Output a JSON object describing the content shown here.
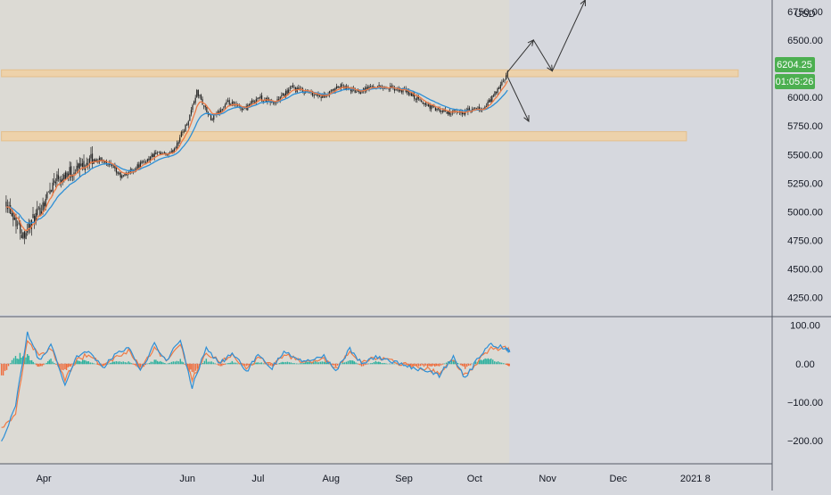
{
  "currency": "USD",
  "colors": {
    "background": "#d6d8de",
    "history_shade": "#dcdad4",
    "zone": "#f0d2a6",
    "zone_stroke": "#e6bd84",
    "candle": "#222222",
    "ema_fast": "#ef7a45",
    "ema_slow": "#2d8fd6",
    "hist_pos": "#2bb19e",
    "hist_neg": "#ef6b3b",
    "price_tag": "#4caf50",
    "divider": "#555a66",
    "arrow": "#333333"
  },
  "price_tag": {
    "value": "6204.25",
    "timer": "01:05:26"
  },
  "chart_data": [
    {
      "type": "line",
      "panel": "price",
      "title": "",
      "ylabel": "",
      "yaxis_unit": "USD",
      "ylim": [
        4100,
        6850
      ],
      "grid": false,
      "y_ticks": [
        4250,
        4500,
        4750,
        5000,
        5250,
        5500,
        5750,
        6000,
        6250,
        6500,
        6750
      ],
      "y_tick_labels": [
        "4250.00",
        "4500.00",
        "4750.00",
        "5000.00",
        "5250.00",
        "5500.00",
        "5750.00",
        "6000.00",
        "",
        "6500.00",
        "6750.00"
      ],
      "x_ticks": [
        {
          "label": "Apr",
          "date": "2020-04-01"
        },
        {
          "label": "Jun",
          "date": "2020-06-01"
        },
        {
          "label": "Jul",
          "date": "2020-07-01"
        },
        {
          "label": "Aug",
          "date": "2020-08-01"
        },
        {
          "label": "Sep",
          "date": "2020-09-01"
        },
        {
          "label": "Oct",
          "date": "2020-10-01"
        },
        {
          "label": "Nov",
          "date": "2020-11-01"
        },
        {
          "label": "Dec",
          "date": "2020-12-01"
        },
        {
          "label": "2021",
          "date": "2021-01-01"
        },
        {
          "label": "8",
          "date": "2021-01-08"
        }
      ],
      "series": [
        {
          "role": "price",
          "x": [
            "2020-03-16",
            "2020-03-23",
            "2020-03-30",
            "2020-04-06",
            "2020-04-13",
            "2020-04-20",
            "2020-04-27",
            "2020-05-04",
            "2020-05-11",
            "2020-05-18",
            "2020-05-25",
            "2020-06-01",
            "2020-06-05",
            "2020-06-11",
            "2020-06-18",
            "2020-06-25",
            "2020-07-01",
            "2020-07-08",
            "2020-07-15",
            "2020-07-22",
            "2020-07-29",
            "2020-08-05",
            "2020-08-12",
            "2020-08-19",
            "2020-08-26",
            "2020-09-02",
            "2020-09-09",
            "2020-09-16",
            "2020-09-23",
            "2020-09-28",
            "2020-10-05",
            "2020-10-12",
            "2020-10-15"
          ],
          "values": [
            5100,
            4800,
            5000,
            5300,
            5350,
            5450,
            5450,
            5300,
            5400,
            5500,
            5500,
            5780,
            6050,
            5800,
            5950,
            5900,
            6000,
            5950,
            6080,
            6050,
            6000,
            6100,
            6050,
            6100,
            6080,
            6050,
            5950,
            5880,
            5860,
            5880,
            5900,
            6100,
            6204
          ]
        }
      ],
      "zones": [
        {
          "low": 6180,
          "high": 6240,
          "from": "2020-03-14",
          "to": "2021-01-21"
        },
        {
          "low": 5620,
          "high": 5700,
          "from": "2020-03-14",
          "to": "2020-12-30"
        }
      ],
      "projection_arrows": [
        {
          "from": {
            "x": "2020-10-15",
            "y": 6220
          },
          "to": {
            "x": "2020-10-26",
            "y": 6500
          }
        },
        {
          "from": {
            "x": "2020-10-26",
            "y": 6500
          },
          "to": {
            "x": "2020-11-03",
            "y": 6230
          }
        },
        {
          "from": {
            "x": "2020-11-03",
            "y": 6230
          },
          "to": {
            "x": "2020-11-17",
            "y": 6850
          }
        },
        {
          "from": {
            "x": "2020-10-15",
            "y": 6180
          },
          "to": {
            "x": "2020-10-24",
            "y": 5790
          }
        }
      ]
    },
    {
      "type": "line",
      "panel": "oscillator",
      "title": "",
      "ylim": [
        -260,
        120
      ],
      "y_ticks": [
        100,
        0,
        -100,
        -200
      ],
      "y_tick_labels": [
        "100.00",
        "0.00",
        "−100.00",
        "−200.00"
      ],
      "x": [
        "2020-03-14",
        "2020-03-20",
        "2020-03-25",
        "2020-03-30",
        "2020-04-04",
        "2020-04-10",
        "2020-04-15",
        "2020-04-20",
        "2020-04-26",
        "2020-05-01",
        "2020-05-07",
        "2020-05-12",
        "2020-05-18",
        "2020-05-23",
        "2020-05-29",
        "2020-06-03",
        "2020-06-09",
        "2020-06-15",
        "2020-06-20",
        "2020-06-26",
        "2020-07-01",
        "2020-07-07",
        "2020-07-12",
        "2020-07-18",
        "2020-07-23",
        "2020-07-29",
        "2020-08-03",
        "2020-08-09",
        "2020-08-14",
        "2020-08-20",
        "2020-08-25",
        "2020-08-31",
        "2020-09-05",
        "2020-09-11",
        "2020-09-16",
        "2020-09-22",
        "2020-09-27",
        "2020-10-03",
        "2020-10-08",
        "2020-10-14",
        "2020-10-16"
      ],
      "series": [
        {
          "role": "fast",
          "values": [
            -200,
            -110,
            80,
            10,
            50,
            -60,
            20,
            30,
            -10,
            20,
            40,
            -20,
            50,
            10,
            60,
            -60,
            40,
            0,
            30,
            -20,
            20,
            -10,
            30,
            10,
            10,
            20,
            -20,
            40,
            0,
            20,
            10,
            0,
            -10,
            -20,
            -30,
            20,
            -40,
            20,
            50,
            40,
            30
          ]
        },
        {
          "role": "signal",
          "values": [
            -170,
            -130,
            60,
            20,
            40,
            -40,
            10,
            25,
            -5,
            15,
            35,
            -10,
            40,
            10,
            50,
            -40,
            30,
            5,
            25,
            -15,
            15,
            -5,
            25,
            10,
            5,
            15,
            -15,
            30,
            5,
            15,
            10,
            0,
            -5,
            -15,
            -25,
            10,
            -30,
            10,
            40,
            40,
            35
          ]
        },
        {
          "role": "histogram",
          "values": [
            -30,
            20,
            20,
            -10,
            10,
            -20,
            10,
            5,
            -5,
            5,
            5,
            -10,
            10,
            0,
            10,
            -20,
            10,
            -5,
            5,
            -5,
            5,
            -5,
            5,
            0,
            5,
            5,
            -5,
            10,
            -5,
            5,
            0,
            0,
            -5,
            -5,
            -5,
            10,
            -10,
            10,
            10,
            0,
            -5
          ]
        }
      ]
    }
  ]
}
